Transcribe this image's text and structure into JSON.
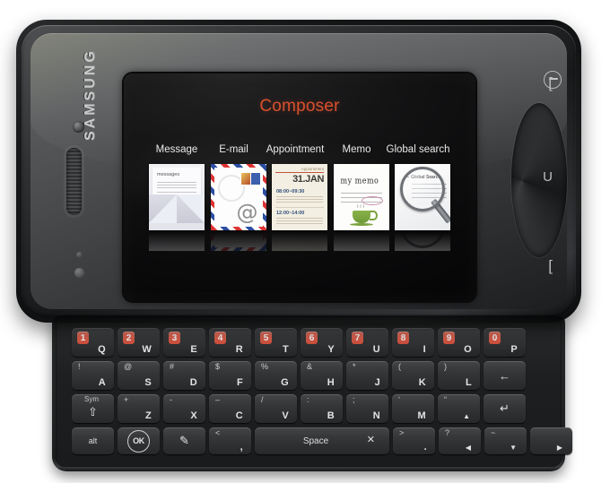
{
  "device": {
    "brand": "SAMSUNG",
    "body_color": "#1b1d1e",
    "accent_color": "#d9502e"
  },
  "screen": {
    "title": "Composer",
    "title_color": "#d9502e",
    "background_color": "#0a0a0b",
    "items": [
      {
        "label": "Message",
        "thumb": {
          "kind": "messages-envelope",
          "heading": "messages",
          "lines": 6
        }
      },
      {
        "label": "E-mail",
        "thumb": {
          "kind": "airmail-envelope",
          "symbol": "@",
          "stamps": 2
        }
      },
      {
        "label": "Appointment",
        "thumb": {
          "kind": "appointment-page",
          "header": "Appointment",
          "date": "31.JAN",
          "slots": [
            "08:00~09:30",
            "12:00~14:00"
          ]
        }
      },
      {
        "label": "Memo",
        "thumb": {
          "kind": "memo-note",
          "handwriting": "my memo",
          "illustration": "coffee-cup"
        }
      },
      {
        "label": "Global search",
        "thumb": {
          "kind": "magnifier-search",
          "heading": "Global Search",
          "lines": 4
        }
      }
    ]
  },
  "side_keys": [
    {
      "name": "volume-key",
      "glyph": "["
    },
    {
      "name": "camera-key",
      "glyph": "U"
    },
    {
      "name": "lock-key",
      "glyph": "["
    }
  ],
  "keyboard": {
    "rows": [
      {
        "name": "row-numbers",
        "keys": [
          {
            "num": "1",
            "main": "Q"
          },
          {
            "num": "2",
            "main": "W"
          },
          {
            "num": "3",
            "main": "E"
          },
          {
            "num": "4",
            "main": "R"
          },
          {
            "num": "5",
            "main": "T"
          },
          {
            "num": "6",
            "main": "Y"
          },
          {
            "num": "7",
            "main": "U"
          },
          {
            "num": "8",
            "main": "I"
          },
          {
            "num": "9",
            "main": "O"
          },
          {
            "num": "0",
            "main": "P"
          }
        ]
      },
      {
        "name": "row-home",
        "keys": [
          {
            "sec": "!",
            "main": "A"
          },
          {
            "sec": "@",
            "main": "S"
          },
          {
            "sec": "#",
            "main": "D"
          },
          {
            "sec": "$",
            "main": "F"
          },
          {
            "sec": "%",
            "main": "G"
          },
          {
            "sec": "&",
            "main": "H"
          },
          {
            "sec": "*",
            "main": "J"
          },
          {
            "sec": "(",
            "main": "K"
          },
          {
            "sec": ")",
            "main": "L"
          },
          {
            "sec": "",
            "main": "",
            "center": "←",
            "label": "backspace"
          }
        ]
      },
      {
        "name": "row-bottom-letters",
        "keys": [
          {
            "sec": "Sym",
            "main": "",
            "center": "⇧",
            "label": "shift-sym"
          },
          {
            "sec": "+",
            "main": "Z"
          },
          {
            "sec": "-",
            "main": "X"
          },
          {
            "sec": "–",
            "main": "C"
          },
          {
            "sec": "/",
            "main": "V"
          },
          {
            "sec": ":",
            "main": "B"
          },
          {
            "sec": ";",
            "main": "N"
          },
          {
            "sec": "‘",
            "main": "M"
          },
          {
            "sec": "“",
            "main": "▲",
            "label": "up-arrow"
          },
          {
            "sec": "",
            "main": "",
            "center": "↵",
            "label": "enter"
          }
        ]
      },
      {
        "name": "row-space",
        "keys": [
          {
            "center": "alt",
            "label": "alt"
          },
          {
            "center": "OK",
            "label": "ok"
          },
          {
            "center": "✎",
            "label": "edit"
          },
          {
            "sec": "<",
            "main": ",",
            "label": "comma"
          },
          {
            "center": "Space",
            "label": "space",
            "extra": "✕"
          },
          {
            "sec": ">",
            "main": ".",
            "label": "period"
          },
          {
            "sec": "?",
            "main": "◀",
            "label": "left-arrow"
          },
          {
            "sec": "~",
            "main": "▼",
            "label": "down-arrow"
          },
          {
            "main": "▶",
            "label": "right-arrow"
          }
        ]
      }
    ]
  }
}
